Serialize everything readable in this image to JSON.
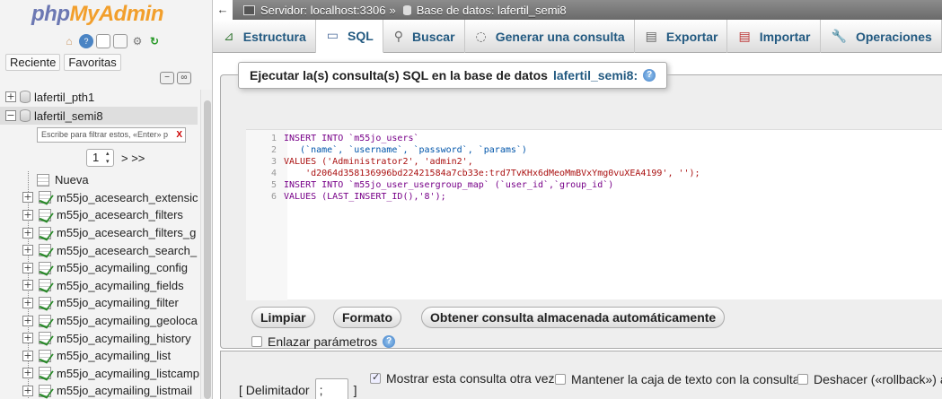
{
  "nav": {
    "logo_php": "php",
    "logo_myadmin": "MyAdmin",
    "tab_recent": "Reciente",
    "tab_favorites": "Favoritas",
    "databases": [
      "lafertil_pth1",
      "lafertil_semi8"
    ],
    "filter_placeholder": "Escribe para filtrar estos, «Enter» p",
    "pager_value": "1",
    "pager_next": "> >>",
    "new_label": "Nueva",
    "tables": [
      "m55jo_acesearch_extensic",
      "m55jo_acesearch_filters",
      "m55jo_acesearch_filters_g",
      "m55jo_acesearch_search_",
      "m55jo_acymailing_config",
      "m55jo_acymailing_fields",
      "m55jo_acymailing_filter",
      "m55jo_acymailing_geoloca",
      "m55jo_acymailing_history",
      "m55jo_acymailing_list",
      "m55jo_acymailing_listcamp",
      "m55jo_acymailing_listmail"
    ]
  },
  "breadcrumb": {
    "server": "Servidor: localhost:3306",
    "separator": "»",
    "database": "Base de datos: lafertil_semi8"
  },
  "tabs": [
    "Estructura",
    "SQL",
    "Buscar",
    "Generar una consulta",
    "Exportar",
    "Importar",
    "Operaciones"
  ],
  "main": {
    "legend_text": "Ejecutar la(s) consulta(s) SQL en la base de datos",
    "legend_db": "lafertil_semi8:",
    "code_lines": [
      {
        "n": "1",
        "text": "INSERT INTO `m55jo_users`"
      },
      {
        "n": "2",
        "text": "   (`name`, `username`, `password`, `params`)"
      },
      {
        "n": "3",
        "text": "VALUES ('Administrator2', 'admin2',"
      },
      {
        "n": "4",
        "text": "    'd2064d358136996bd22421584a7cb33e:trd7TvKHx6dMeoMmBVxYmg0vuXEA4199', '');"
      },
      {
        "n": "5",
        "text": "INSERT INTO `m55jo_user_usergroup_map` (`user_id`,`group_id`)"
      },
      {
        "n": "6",
        "text": "VALUES (LAST_INSERT_ID(),'8');"
      }
    ],
    "btn_clear": "Limpiar",
    "btn_format": "Formato",
    "btn_stored": "Obtener consulta almacenada automáticamente",
    "bind_params": "Enlazar parámetros"
  },
  "options": {
    "delimiter_label": "[ Delimitador",
    "delimiter_value": ";",
    "delimiter_close": "]",
    "show_query": "Mostrar esta consulta otra vez",
    "keep_box": "Mantener la caja de texto con la consulta",
    "rollback": "Deshacer («rollback») al"
  }
}
